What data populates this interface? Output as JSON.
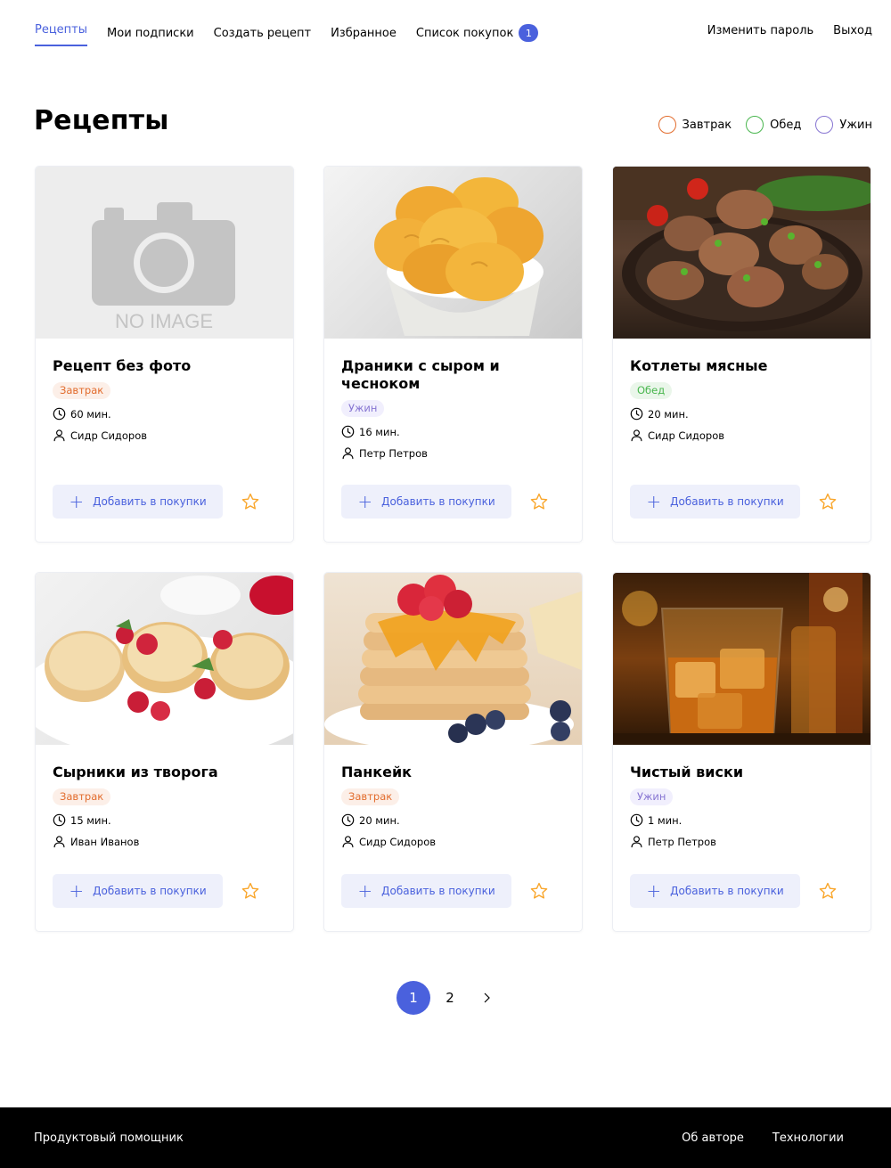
{
  "header": {
    "nav": [
      {
        "label": "Рецепты"
      },
      {
        "label": "Мои подписки"
      },
      {
        "label": "Создать рецепт"
      },
      {
        "label": "Избранное"
      },
      {
        "label": "Список покупок",
        "badge": "1"
      }
    ],
    "right": [
      {
        "label": "Изменить пароль"
      },
      {
        "label": "Выход"
      }
    ]
  },
  "page": {
    "title": "Рецепты",
    "filters": [
      {
        "label": "Завтрак",
        "color": "#e26c2d"
      },
      {
        "label": "Обед",
        "color": "#49b64e"
      },
      {
        "label": "Ужин",
        "color": "#8775d2"
      }
    ]
  },
  "colors": {
    "accent": "#4a61dd",
    "breakfast": "#e26c2d",
    "lunch": "#49b64e",
    "dinner": "#8775d2",
    "star": "#f9a62b"
  },
  "cards": [
    {
      "title": "Рецепт без фото",
      "tag": "Завтрак",
      "time": "60 мин.",
      "author": "Сидр Сидоров",
      "image": "placeholder",
      "image_text": "NO IMAGE"
    },
    {
      "title": "Драники с сыром и чесноком",
      "tag": "Ужин",
      "time": "16 мин.",
      "author": "Петр Петров",
      "image": "potato-pancakes"
    },
    {
      "title": "Котлеты мясные",
      "tag": "Обед",
      "time": "20 мин.",
      "author": "Сидр Сидоров",
      "image": "meat-cutlets"
    },
    {
      "title": "Сырники из творога",
      "tag": "Завтрак",
      "time": "15 мин.",
      "author": "Иван Иванов",
      "image": "cheese-pancakes"
    },
    {
      "title": "Панкейк",
      "tag": "Завтрак",
      "time": "20 мин.",
      "author": "Сидр Сидоров",
      "image": "pancake-stack"
    },
    {
      "title": "Чистый виски",
      "tag": "Ужин",
      "time": "1 мин.",
      "author": "Петр Петров",
      "image": "whiskey-glass"
    }
  ],
  "card_button": {
    "label": "Добавить в покупки"
  },
  "pagination": {
    "pages": [
      "1",
      "2"
    ],
    "current": "1",
    "next_icon": "chevron-right-icon"
  },
  "footer": {
    "brand": "Продуктовый помощник",
    "links": [
      {
        "label": "Об авторе"
      },
      {
        "label": "Технологии"
      }
    ]
  }
}
